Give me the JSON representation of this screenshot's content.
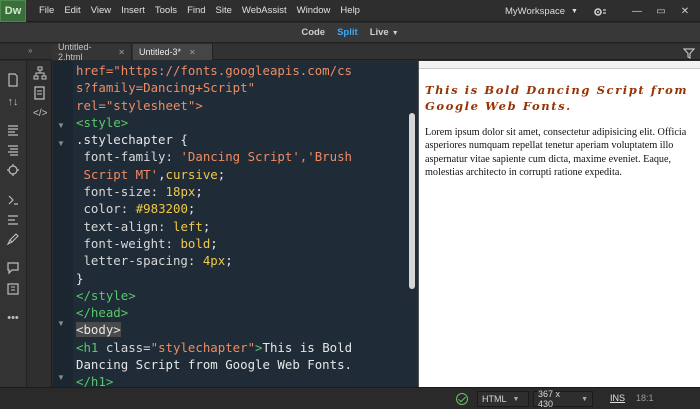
{
  "app": {
    "logo": "Dw",
    "menu": [
      "File",
      "Edit",
      "View",
      "Insert",
      "Tools",
      "Find",
      "Site",
      "WebAssist",
      "Window",
      "Help"
    ],
    "workspace": "MyWorkspace"
  },
  "view_modes": {
    "code": "Code",
    "split": "Split",
    "live": "Live",
    "active": "Split"
  },
  "tabs": [
    {
      "label": "Untitled-2.html"
    },
    {
      "label": "Untitled-3*"
    }
  ],
  "code_lines": [
    [
      {
        "t": "href=\"https://fonts.googleapis.com/cs",
        "c": "c-str"
      }
    ],
    [
      {
        "t": "s?family=Dancing+Script\"",
        "c": "c-str"
      }
    ],
    [
      {
        "t": "rel=\"stylesheet\">",
        "c": "c-str"
      }
    ],
    [
      {
        "t": "<style>",
        "c": "c-tag"
      }
    ],
    [
      {
        "t": ".stylechapter {",
        "c": "c-plain"
      }
    ],
    [
      {
        "t": " font-family: ",
        "c": "c-prop"
      },
      {
        "t": "'Dancing Script','Brush",
        "c": "c-str"
      }
    ],
    [
      {
        "t": " Script MT'",
        "c": "c-str"
      },
      {
        "t": ",",
        "c": "c-plain"
      },
      {
        "t": "cursive",
        "c": "c-val"
      },
      {
        "t": ";",
        "c": "c-plain"
      }
    ],
    [
      {
        "t": " font-size: ",
        "c": "c-prop"
      },
      {
        "t": "18px",
        "c": "c-val"
      },
      {
        "t": ";",
        "c": "c-plain"
      }
    ],
    [
      {
        "t": " color: ",
        "c": "c-prop"
      },
      {
        "t": "#983200",
        "c": "c-val"
      },
      {
        "t": ";",
        "c": "c-plain"
      }
    ],
    [
      {
        "t": " text-align: ",
        "c": "c-prop"
      },
      {
        "t": "left",
        "c": "c-val"
      },
      {
        "t": ";",
        "c": "c-plain"
      }
    ],
    [
      {
        "t": " font-weight: ",
        "c": "c-prop"
      },
      {
        "t": "bold",
        "c": "c-val"
      },
      {
        "t": ";",
        "c": "c-plain"
      }
    ],
    [
      {
        "t": " letter-spacing: ",
        "c": "c-prop"
      },
      {
        "t": "4px",
        "c": "c-val"
      },
      {
        "t": ";",
        "c": "c-plain"
      }
    ],
    [
      {
        "t": "}",
        "c": "c-plain"
      }
    ],
    [
      {
        "t": "</style>",
        "c": "c-tag"
      }
    ],
    [
      {
        "t": "</head>",
        "c": "c-tag"
      }
    ],
    [
      {
        "t": "<body>",
        "c": "c-hl"
      }
    ],
    [
      {
        "t": "<h1 ",
        "c": "c-tag"
      },
      {
        "t": "class=",
        "c": "c-attr"
      },
      {
        "t": "\"stylechapter\"",
        "c": "c-str"
      },
      {
        "t": ">",
        "c": "c-tag"
      },
      {
        "t": "This is Bold",
        "c": "c-plain"
      }
    ],
    [
      {
        "t": "Dancing Script from Google Web Fonts.",
        "c": "c-plain"
      }
    ],
    [
      {
        "t": "</h1>",
        "c": "c-tag"
      }
    ]
  ],
  "preview": {
    "heading": "This is Bold Dancing Script from Google Web Fonts.",
    "paragraph": "Lorem ipsum dolor sit amet, consectetur adipisicing elit. Officia asperiores numquam repellat tenetur aperiam voluptatem illo aspernatur vitae sapiente cum dicta, maxime eveniet. Eaque, molestias architecto in corrupti ratione expedita."
  },
  "status": {
    "doc_type": "HTML",
    "window_size": "367 x 430",
    "insert_mode": "INS",
    "cursor_pos": "18:1"
  },
  "colors": {
    "heading": "#983200",
    "active_view": "#3ba8f0",
    "code_bg": "#1f2b36"
  }
}
